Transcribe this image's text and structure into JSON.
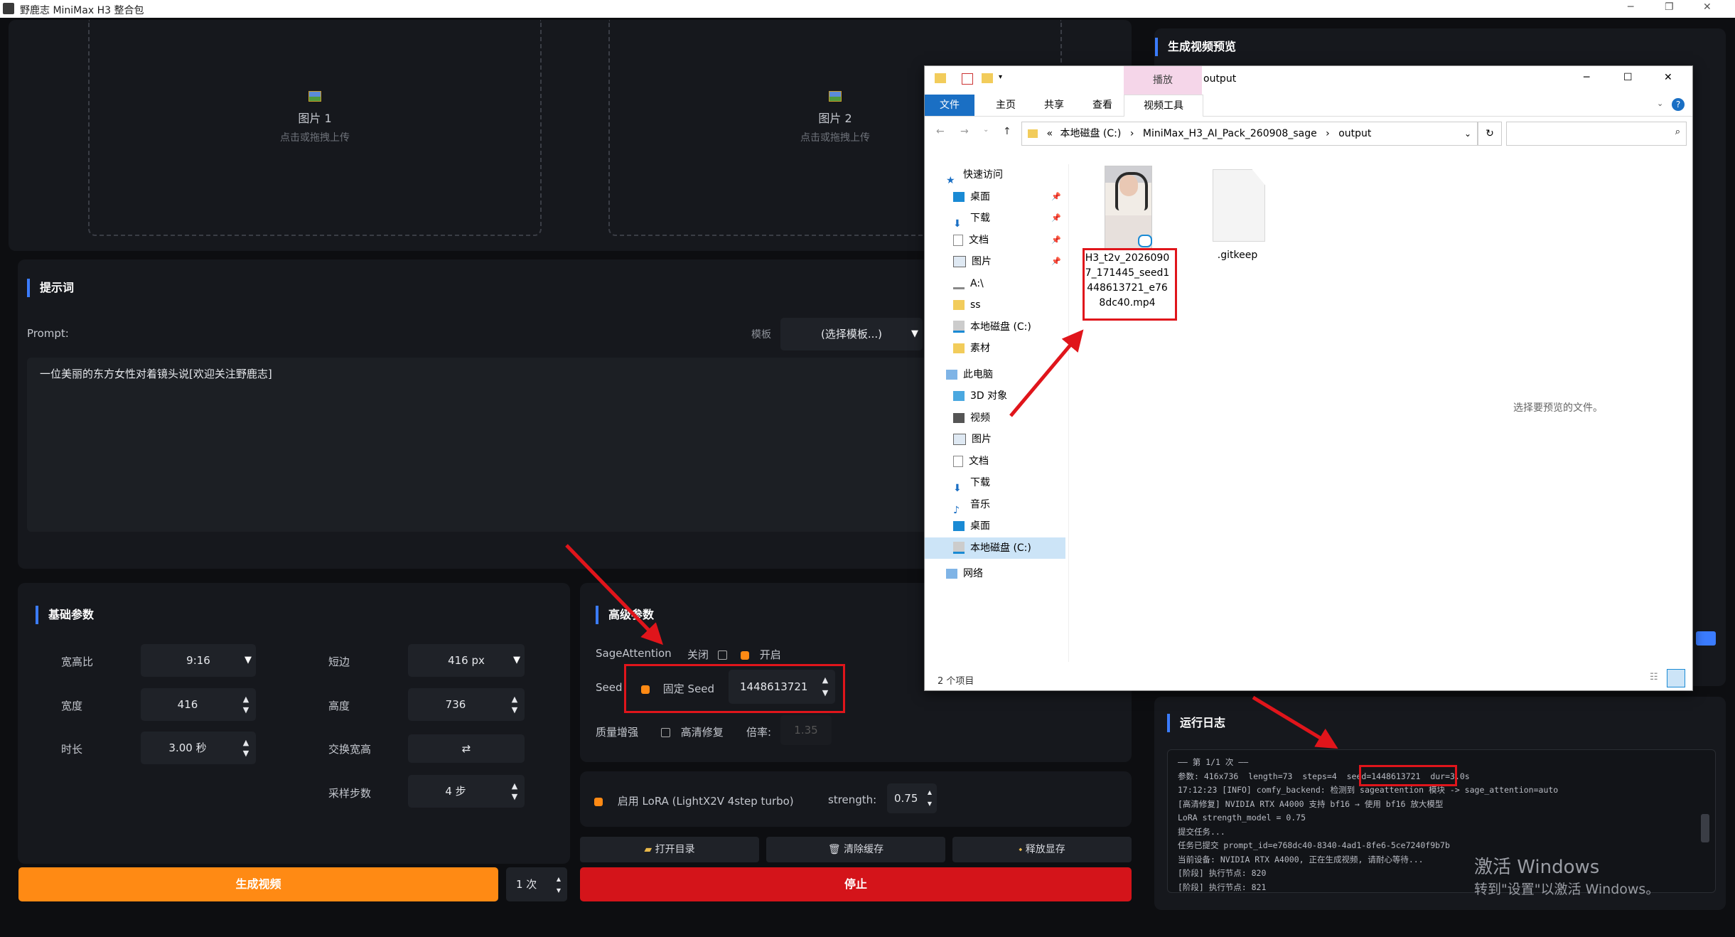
{
  "window": {
    "title": "野鹿志 MiniMax H3 整合包"
  },
  "upload": {
    "img1_label": "图片 1",
    "img1_hint": "点击或拖拽上传",
    "img2_label": "图片 2",
    "img2_hint": "点击或拖拽上传"
  },
  "prompt": {
    "section_title": "提示词",
    "label": "Prompt:",
    "template_label": "模板",
    "template_value": "(选择模板...)",
    "text": "一位美丽的东方女性对着镜头说[欢迎关注野鹿志]"
  },
  "basic": {
    "title": "基础参数",
    "aspect_label": "宽高比",
    "aspect_value": "9:16",
    "short_label": "短边",
    "short_value": "416 px",
    "width_label": "宽度",
    "width_value": "416",
    "height_label": "高度",
    "height_value": "736",
    "duration_label": "时长",
    "duration_value": "3.00 秒",
    "swap_label": "交换宽高",
    "swap_icon": "⇄",
    "steps_label": "采样步数",
    "steps_value": "4 步"
  },
  "advanced": {
    "title": "高级参数",
    "sage_label": "SageAttention",
    "sage_off": "关闭",
    "sage_on": "开启",
    "seed_label": "Seed",
    "fixed_seed": "固定 Seed",
    "seed_value": "1448613721",
    "quality_label": "质量增强",
    "hires_label": "高清修复",
    "ratio_label": "倍率:",
    "ratio_value": "1.35"
  },
  "lora": {
    "label": "启用 LoRA (LightX2V 4step turbo)",
    "strength_label": "strength:",
    "strength_value": "0.75"
  },
  "tools": {
    "open_dir": "打开目录",
    "clear_cache": "清除缓存",
    "free_vram": "释放显存"
  },
  "actions": {
    "generate": "生成视频",
    "count": "1 次",
    "stop": "停止"
  },
  "preview": {
    "title": "生成视频预览"
  },
  "log": {
    "title": "运行日志",
    "lines": [
      "—— 第 1/1 次 ——",
      "参数: 416x736  length=73  steps=4  seed=1448613721  dur=3.0s",
      "17:12:23 [INFO] comfy_backend: 检测到 sageattention 模块 -> sage_attention=auto",
      "[高清修复] NVIDIA RTX A4000 支持 bf16 → 使用 bf16 放大模型",
      "LoRA strength_model = 0.75",
      "提交任务...",
      "任务已提交 prompt_id=e768dc40-8340-4ad1-8fe6-5ce7240f9b7b",
      "当前设备: NVIDIA RTX A4000, 正在生成视频, 请耐心等待...",
      "[阶段] 执行节点: 820",
      "[阶段] 执行节点: 821"
    ]
  },
  "explorer": {
    "title": "output",
    "ribbon_play": "播放",
    "tabs": [
      "文件",
      "主页",
      "共享",
      "查看",
      "视频工具"
    ],
    "path": [
      "本地磁盘 (C:)",
      "MiniMax_H3_AI_Pack_260908_sage",
      "output"
    ],
    "nav": [
      "快速访问",
      "桌面",
      "下载",
      "文档",
      "图片",
      "A:\\",
      "ss",
      "本地磁盘 (C:)",
      "素材",
      "此电脑",
      "3D 对象",
      "视频",
      "图片",
      "文档",
      "下载",
      "音乐",
      "桌面",
      "本地磁盘 (C:)",
      "网络"
    ],
    "file1": "H3_t2v_20260907_171445_seed1448613721_e768dc40.mp4",
    "file2": ".gitkeep",
    "preview_hint": "选择要预览的文件。",
    "status": "2 个项目"
  },
  "watermark": {
    "line1": "激活 Windows",
    "line2": "转到\"设置\"以激活 Windows。"
  },
  "colors": {
    "accent_orange": "#ff8a14",
    "stop_red": "#d4141a",
    "highlight_red": "#e0151b",
    "section_bar": "#3b7cff"
  }
}
